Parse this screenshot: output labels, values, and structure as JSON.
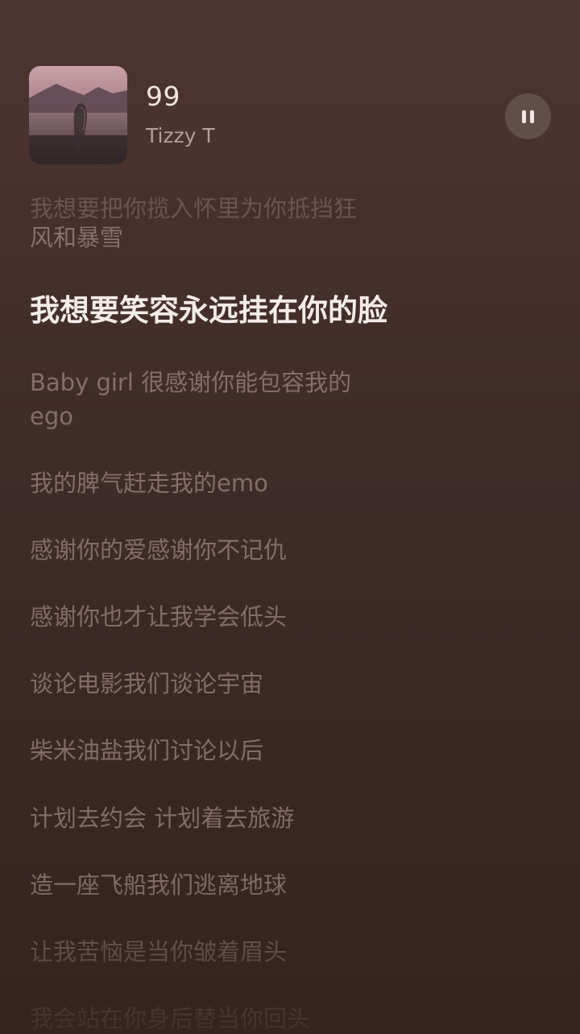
{
  "now_playing": {
    "title": "99",
    "artist": "Tizzy T",
    "control_icon": "pause-icon"
  },
  "lyrics": {
    "partial_top": "我想要把你揽入怀里为你抵挡狂",
    "lines": [
      "风和暴雪",
      "我想要笑容永远挂在你的脸",
      "Baby girl 很感谢你能包容我的",
      "ego",
      "我的脾气赶走我的emo",
      "感谢你的爱感谢你不记仇",
      "感谢你也才让我学会低头",
      "谈论电影我们谈论宇宙",
      "柴米油盐我们讨论以后",
      "计划去约会 计划着去旅游",
      "造一座飞船我们逃离地球",
      "让我苦恼是当你皱着眉头",
      "我会站在你身后替当你回头"
    ],
    "current_index": 1
  },
  "colors": {
    "background_top": "#4d3530",
    "background_bottom": "#35231f",
    "current_lyric": "#f4ece9",
    "dim_lyric": "#c7aaa3"
  }
}
